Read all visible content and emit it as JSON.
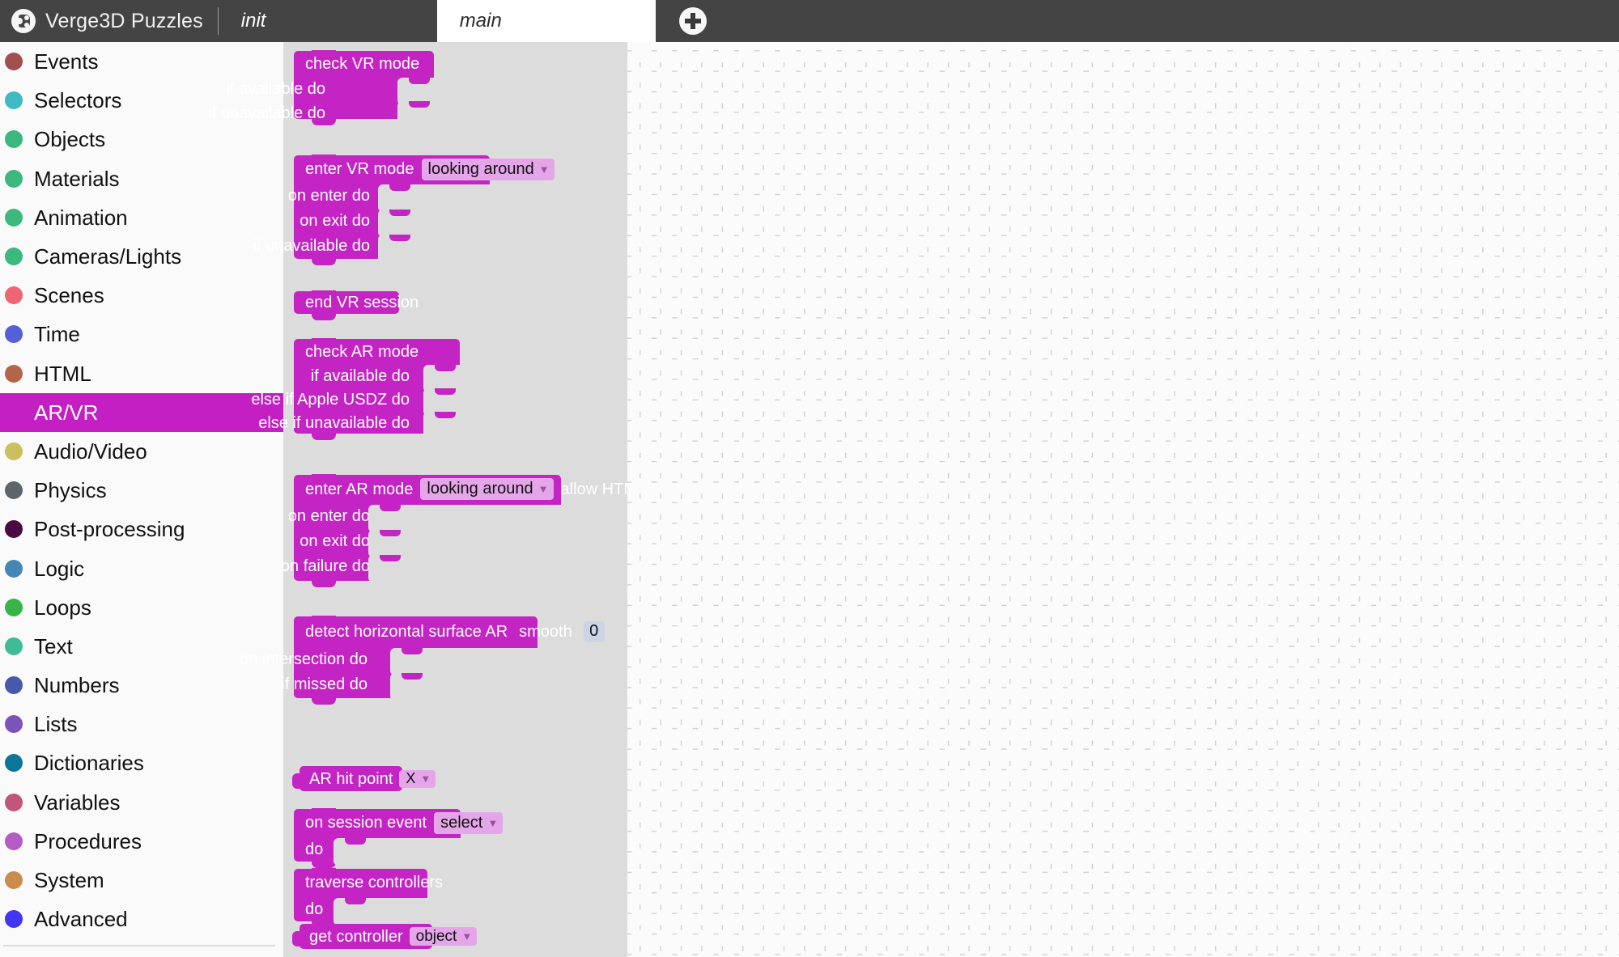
{
  "header": {
    "logo_icon": "verge3d-puzzle-logo",
    "brand_title": "Verge3D Puzzles",
    "add_tab_icon": "plus-circle-icon",
    "tabs": [
      {
        "label": "init",
        "active": false
      },
      {
        "label": "main",
        "active": true
      }
    ]
  },
  "sidebar": {
    "selected": "AR/VR",
    "categories": [
      {
        "label": "Events",
        "color": "#a0514f"
      },
      {
        "label": "Selectors",
        "color": "#3fb9c2"
      },
      {
        "label": "Objects",
        "color": "#3ab87e"
      },
      {
        "label": "Materials",
        "color": "#3ab87e"
      },
      {
        "label": "Animation",
        "color": "#3ab87e"
      },
      {
        "label": "Cameras/Lights",
        "color": "#3ab87e"
      },
      {
        "label": "Scenes",
        "color": "#ef6572"
      },
      {
        "label": "Time",
        "color": "#5360d8"
      },
      {
        "label": "HTML",
        "color": "#b5644c"
      },
      {
        "label": "AR/VR",
        "color": "#c31fc3"
      },
      {
        "label": "Audio/Video",
        "color": "#cbbf5e"
      },
      {
        "label": "Physics",
        "color": "#5d646b"
      },
      {
        "label": "Post-processing",
        "color": "#490a46"
      },
      {
        "label": "Logic",
        "color": "#4388b5"
      },
      {
        "label": "Loops",
        "color": "#37b44a"
      },
      {
        "label": "Text",
        "color": "#3ebd95"
      },
      {
        "label": "Numbers",
        "color": "#4659ab"
      },
      {
        "label": "Lists",
        "color": "#7a54b8"
      },
      {
        "label": "Dictionaries",
        "color": "#0b7699"
      },
      {
        "label": "Variables",
        "color": "#c2557c"
      },
      {
        "label": "Procedures",
        "color": "#b55bc4"
      },
      {
        "label": "System",
        "color": "#cb8b4c"
      },
      {
        "label": "Advanced",
        "color": "#4236f0"
      }
    ]
  },
  "flyout": {
    "category_color": "#c324c3",
    "blocks": [
      {
        "name": "check-vr-mode-block",
        "title": "check VR mode",
        "rows": [
          "if available do",
          "if unavailable do"
        ]
      },
      {
        "name": "enter-vr-mode-block",
        "title": "enter VR mode",
        "dropdown": "looking around",
        "rows": [
          "on enter do",
          "on exit do",
          "if unavailable do"
        ]
      },
      {
        "name": "end-vr-session-block",
        "title": "end VR session"
      },
      {
        "name": "check-ar-mode-block",
        "title": "check AR mode",
        "rows": [
          "if available do",
          "else if Apple USDZ do",
          "else if unavailable do"
        ]
      },
      {
        "name": "enter-ar-mode-block",
        "title": "enter AR mode",
        "dropdown": "looking around",
        "checkbox_label": "allow HTML",
        "checkbox_checked": false,
        "rows": [
          "on enter do",
          "on exit do",
          "on failure do"
        ]
      },
      {
        "name": "detect-horizontal-surface-ar-block",
        "title": "detect horizontal surface AR",
        "field_label": "smooth",
        "field_value": "0",
        "rows": [
          "on intersection do",
          "if missed do"
        ]
      },
      {
        "name": "ar-hit-point-block",
        "title": "AR hit point",
        "dropdown": "X"
      },
      {
        "name": "on-session-event-block",
        "title": "on session event",
        "dropdown": "select",
        "rows": [
          "do"
        ]
      },
      {
        "name": "traverse-controllers-block",
        "title": "traverse controllers",
        "rows": [
          "do"
        ]
      },
      {
        "name": "get-controller-block",
        "title": "get controller",
        "dropdown": "object"
      }
    ]
  }
}
